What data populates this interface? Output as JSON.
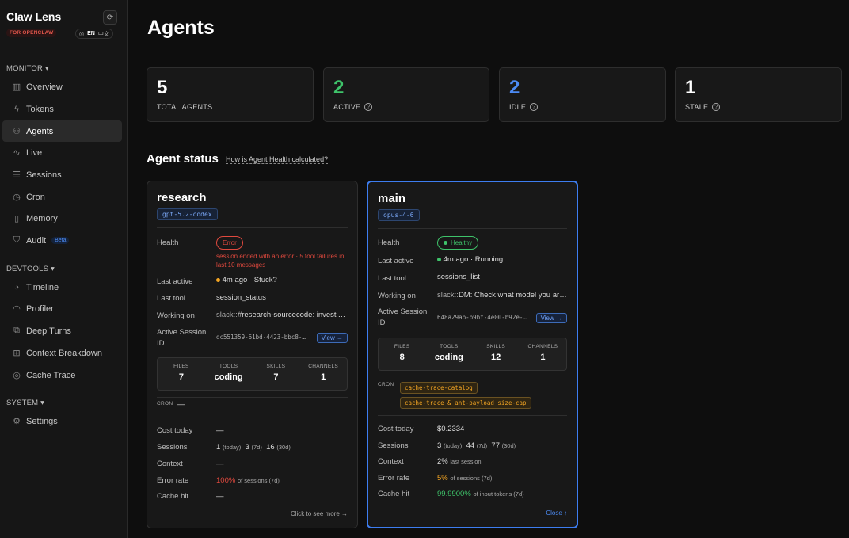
{
  "brand": {
    "title": "Claw Lens",
    "subtitle": "FOR OPENCLAW",
    "lang_en": "EN",
    "lang_zh": "中文"
  },
  "sidebar": {
    "monitor_title": "MONITOR",
    "monitor_items": [
      {
        "label": "Overview",
        "icon": "bar-chart-icon"
      },
      {
        "label": "Tokens",
        "icon": "bolt-icon"
      },
      {
        "label": "Agents",
        "icon": "users-icon"
      },
      {
        "label": "Live",
        "icon": "pulse-icon"
      },
      {
        "label": "Sessions",
        "icon": "list-icon"
      },
      {
        "label": "Cron",
        "icon": "clock-icon"
      },
      {
        "label": "Memory",
        "icon": "book-icon"
      },
      {
        "label": "Audit",
        "icon": "shield-icon",
        "badge": "Beta"
      }
    ],
    "devtools_title": "DEVTOOLS",
    "devtools_items": [
      {
        "label": "Timeline",
        "icon": "timeline-icon"
      },
      {
        "label": "Profiler",
        "icon": "gauge-icon"
      },
      {
        "label": "Deep Turns",
        "icon": "layers-icon"
      },
      {
        "label": "Context Breakdown",
        "icon": "grid-icon"
      },
      {
        "label": "Cache Trace",
        "icon": "target-icon"
      }
    ],
    "system_title": "SYSTEM",
    "system_items": [
      {
        "label": "Settings",
        "icon": "gear-icon"
      }
    ]
  },
  "page": {
    "title": "Agents"
  },
  "stats": [
    {
      "value": "5",
      "label": "TOTAL AGENTS",
      "color": "#ffffff"
    },
    {
      "value": "2",
      "label": "ACTIVE",
      "color": "#3ec36a"
    },
    {
      "value": "2",
      "label": "IDLE",
      "color": "#4c8bf5"
    },
    {
      "value": "1",
      "label": "STALE",
      "color": "#ffffff"
    }
  ],
  "agent_status": {
    "title": "Agent status",
    "link": "How is Agent Health calculated?"
  },
  "labels": {
    "health": "Health",
    "last_active": "Last active",
    "last_tool": "Last tool",
    "working_on": "Working on",
    "active_session_id": "Active Session ID",
    "files": "FILES",
    "tools": "TOOLS",
    "skills": "SKILLS",
    "channels": "CHANNELS",
    "cron": "CRON",
    "cost_today": "Cost today",
    "sessions": "Sessions",
    "context": "Context",
    "error_rate": "Error rate",
    "cache_hit": "Cache hit",
    "view": "View →"
  },
  "agents": [
    {
      "name": "research",
      "model": "gpt-5.2-codex",
      "health": "Error",
      "health_note": "session ended with an error · 5 tool failures in last 10 messages",
      "last_active": "4m ago · Stuck?",
      "last_tool": "session_status",
      "working_on_prefix": "slack::",
      "working_on": "#research-sourcecode: investigate",
      "session_id": "dc551359-61bd-4423-bbc8-…",
      "files": "7",
      "tools": "coding",
      "skills": "7",
      "channels": "1",
      "cron": "—",
      "cost_today": "—",
      "sessions_today": "1",
      "sessions_today_unit": "(today)",
      "sessions_7d": "3",
      "sessions_7d_unit": "(7d)",
      "sessions_30d": "16",
      "sessions_30d_unit": "(30d)",
      "context": "—",
      "error_rate": "100%",
      "error_rate_unit": "of sessions (7d)",
      "cache_hit": "—",
      "footer": "Click to see more →"
    },
    {
      "name": "main",
      "model": "opus-4-6",
      "health": "Healthy",
      "last_active": "4m ago · Running",
      "last_tool": "sessions_list",
      "working_on_prefix": "slack::",
      "working_on": "DM: Check what model you are running",
      "session_id": "648a29ab-b9bf-4e00-b92e-…",
      "files": "8",
      "tools": "coding",
      "skills": "12",
      "channels": "1",
      "cron_tags": [
        "cache-trace-catalog",
        "cache-trace & ant-payload size-cap"
      ],
      "cost_today": "$0.2334",
      "sessions_today": "3",
      "sessions_today_unit": "(today)",
      "sessions_7d": "44",
      "sessions_7d_unit": "(7d)",
      "sessions_30d": "77",
      "sessions_30d_unit": "(30d)",
      "context": "2%",
      "context_unit": "last session",
      "error_rate": "5%",
      "error_rate_unit": "of sessions (7d)",
      "cache_hit": "99.9900%",
      "cache_hit_unit": "of input tokens (7d)",
      "footer": "Close ↑"
    }
  ]
}
